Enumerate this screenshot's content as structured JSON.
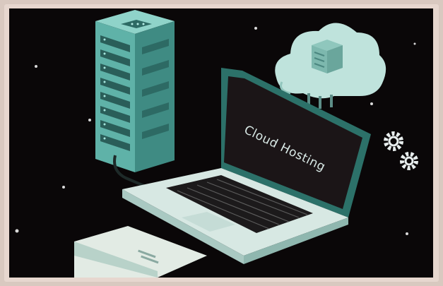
{
  "illustration": {
    "screen_label": "Cloud Hosting"
  },
  "colors": {
    "background": "#0a0708",
    "teal": "#78c8be",
    "teal_dark": "#2f6d67",
    "cloud": "#bfe3dc",
    "laptop_body": "#d7e8e3",
    "screen": "#1b1517",
    "gears": "#e8eeee",
    "frame": "#e7d7cf"
  },
  "icons": [
    "server-icon",
    "cloud-icon",
    "laptop-icon",
    "gear-icon",
    "stars"
  ]
}
